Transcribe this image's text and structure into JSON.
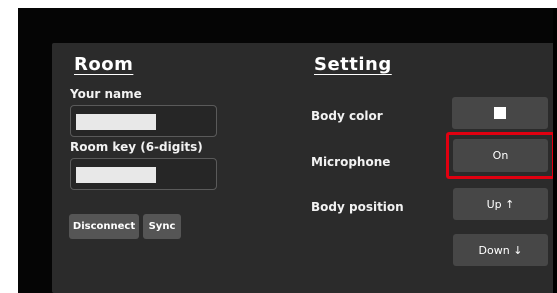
{
  "room": {
    "title": "Room",
    "your_name_label": "Your name",
    "room_key_label": "Room key (6-digits)",
    "disconnect_label": "Disconnect",
    "sync_label": "Sync"
  },
  "setting": {
    "title": "Setting",
    "body_color_label": "Body color",
    "body_color_value": "#ffffff",
    "microphone_label": "Microphone",
    "microphone_value": "On",
    "body_position_label": "Body position",
    "up_label": "Up ↑",
    "down_label": "Down ↓"
  },
  "colors": {
    "panel_bg": "#2b2b2b",
    "highlight": "#e00010"
  }
}
